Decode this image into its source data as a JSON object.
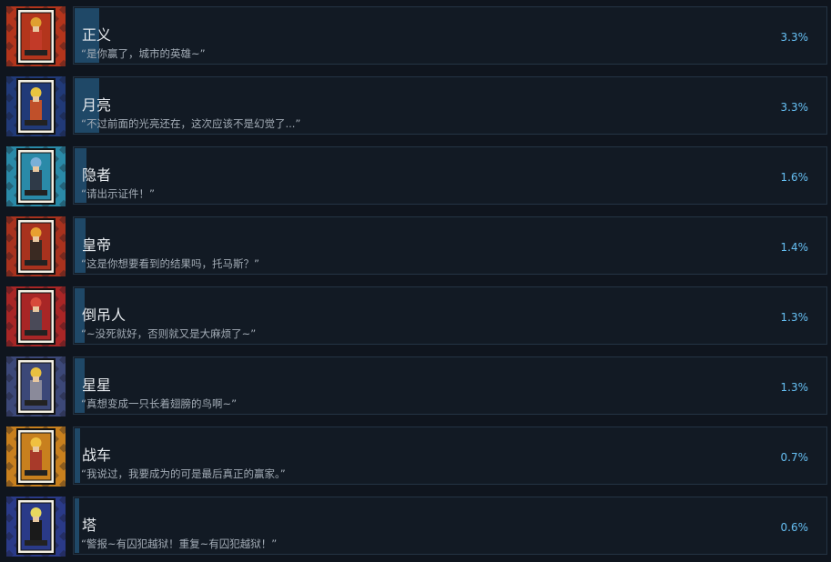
{
  "achievements": [
    {
      "title": "正义",
      "description": "“是你赢了，城市的英雄~”",
      "percent_label": "3.3%",
      "percent": 3.3,
      "icon": "justice-tarot-card-icon",
      "colors": {
        "bg": "#b3351c",
        "accent": "#e0a030",
        "figure": "#c23a28"
      }
    },
    {
      "title": "月亮",
      "description": "“不过前面的光亮还在，这次应该不是幻觉了...”",
      "percent_label": "3.3%",
      "percent": 3.3,
      "icon": "moon-tarot-card-icon",
      "colors": {
        "bg": "#213a78",
        "accent": "#e8c440",
        "figure": "#c0502a"
      }
    },
    {
      "title": "隐者",
      "description": "“请出示证件！”",
      "percent_label": "1.6%",
      "percent": 1.6,
      "icon": "hermit-tarot-card-icon",
      "colors": {
        "bg": "#2a8aa8",
        "accent": "#7ab0d8",
        "figure": "#2f3a48"
      }
    },
    {
      "title": "皇帝",
      "description": "“这是你想要看到的结果吗，托马斯？”",
      "percent_label": "1.4%",
      "percent": 1.4,
      "icon": "emperor-tarot-card-icon",
      "colors": {
        "bg": "#a8321e",
        "accent": "#e8a030",
        "figure": "#3a2a22"
      }
    },
    {
      "title": "倒吊人",
      "description": "“~没死就好，否则就又是大麻烦了~”",
      "percent_label": "1.3%",
      "percent": 1.3,
      "icon": "hanged-man-tarot-card-icon",
      "colors": {
        "bg": "#a82626",
        "accent": "#d84a3a",
        "figure": "#4a4a58"
      }
    },
    {
      "title": "星星",
      "description": "“真想变成一只长着翅膀的鸟啊~”",
      "percent_label": "1.3%",
      "percent": 1.3,
      "icon": "star-tarot-card-icon",
      "colors": {
        "bg": "#3c4878",
        "accent": "#e8c040",
        "figure": "#8a8a9a"
      }
    },
    {
      "title": "战车",
      "description": "“我说过，我要成为的可是最后真正的赢家。”",
      "percent_label": "0.7%",
      "percent": 0.7,
      "icon": "chariot-tarot-card-icon",
      "colors": {
        "bg": "#c8801e",
        "accent": "#f0c040",
        "figure": "#a83a2a"
      }
    },
    {
      "title": "塔",
      "description": "“警报~有囚犯越狱！重复~有囚犯越狱！”",
      "percent_label": "0.6%",
      "percent": 0.6,
      "icon": "tower-tarot-card-icon",
      "colors": {
        "bg": "#2a3a88",
        "accent": "#e8d860",
        "figure": "#1a1a1a"
      }
    }
  ]
}
